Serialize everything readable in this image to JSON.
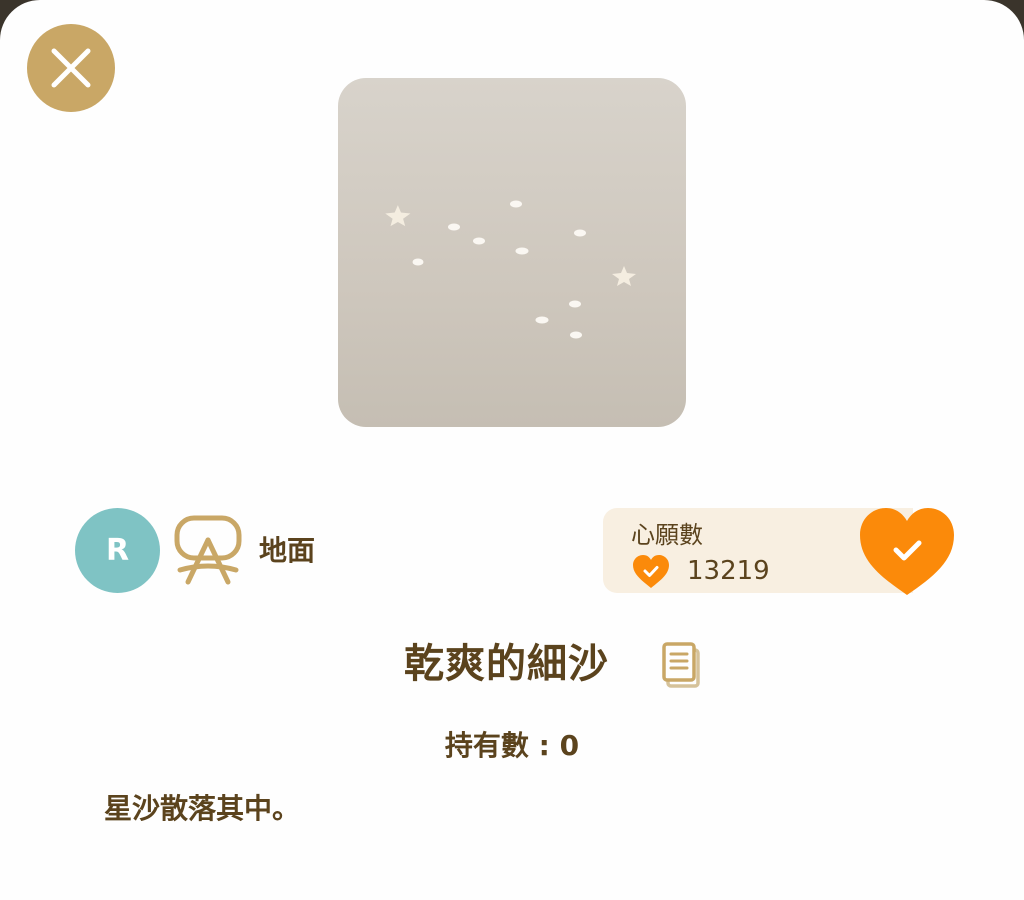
{
  "close": {
    "icon": "close-icon"
  },
  "item": {
    "image_icon": "star-sand-image",
    "rarity": "R",
    "category_icon": "ground-stand-icon",
    "category": "地面",
    "name": "乾爽的細沙",
    "owned": "持有數 : 0",
    "description": "星沙散落其中。"
  },
  "wish": {
    "label": "心願數",
    "count": "13219",
    "icon": "heart-check-icon"
  },
  "colors": {
    "gold": "#c9a766",
    "brown_text": "#5b431d",
    "orange": "#fb8a0a",
    "rarity_teal": "#7fc3c4",
    "wish_bg": "#f8efe1"
  }
}
